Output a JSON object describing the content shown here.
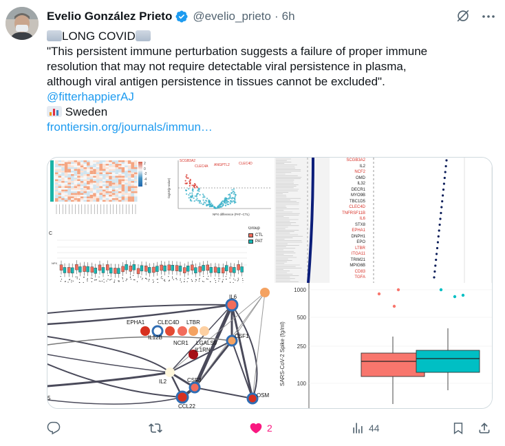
{
  "author": {
    "name": "Evelio González Prieto",
    "handle": "@evelio_prieto",
    "separator": "·",
    "time": "6h"
  },
  "tweet": {
    "heading": "LONG COVID",
    "quote_line1": "\"This persistent immune perturbation suggests a failure of proper immune",
    "quote_line2": "resolution that may not require detectable viral persistence in plasma,",
    "quote_line3": "although viral antigen persistence in tissues cannot be excluded\".",
    "mention": "@fitterhappierAJ",
    "country": "Sweden",
    "link_text": "frontiersin.org/journals/immun…"
  },
  "icons": {
    "verified": "verified-badge-icon",
    "grok": "grok-icon",
    "more": "more-icon",
    "reply": "reply-icon",
    "retweet": "retweet-icon",
    "like": "heart-icon",
    "views": "views-icon",
    "bookmark": "bookmark-icon",
    "share": "share-icon"
  },
  "colors": {
    "link": "#1d9bf0",
    "like": "#f91880",
    "muted": "#536471"
  },
  "figure": {
    "legend_title": "Group",
    "legend_ctl": "CTL",
    "legend_pat": "PAT",
    "volcano_xlabel": "NPX difference (PAT−CTL)",
    "volcano_ylabel": "-log10(p-value)",
    "volcano_labels": [
      "SCGB3A2",
      "CLEC4A",
      "ANGPTL2",
      "CLEC4D"
    ],
    "heat_scale": [
      "2",
      "0",
      "-2",
      "-4",
      "-6"
    ],
    "dot_genes": [
      "SCGB3A2",
      "IL2",
      "NCF2",
      "OMD",
      "IL32",
      "DECR1",
      "MYO9B",
      "TBC1D5",
      "CLEC4D",
      "TNFRSF11B",
      "IL6",
      "STX8",
      "EPHA1",
      "DNPH1",
      "EPO",
      "LTBR",
      "ITGA11",
      "TRIM21",
      "MPIG6B",
      "CD83",
      "TGFA"
    ],
    "network_nodes": [
      "IL6",
      "EPHA1",
      "CLEC4D",
      "LTBR",
      "IL12B",
      "NCR1",
      "LGALS9",
      "CSF1",
      "IL1RN",
      "IL2",
      "CSF3",
      "CCL22",
      "OSM"
    ],
    "network_index": "5",
    "panel_c": "C",
    "panel_axis_npx": "NPX",
    "spike_ylabel": "SARS-CoV-2 Spike (fg/ml)",
    "spike_ticks": [
      "1000",
      "500",
      "250",
      "100"
    ]
  },
  "metrics": {
    "replies": "",
    "retweets": "",
    "likes": "2",
    "views": "44"
  }
}
